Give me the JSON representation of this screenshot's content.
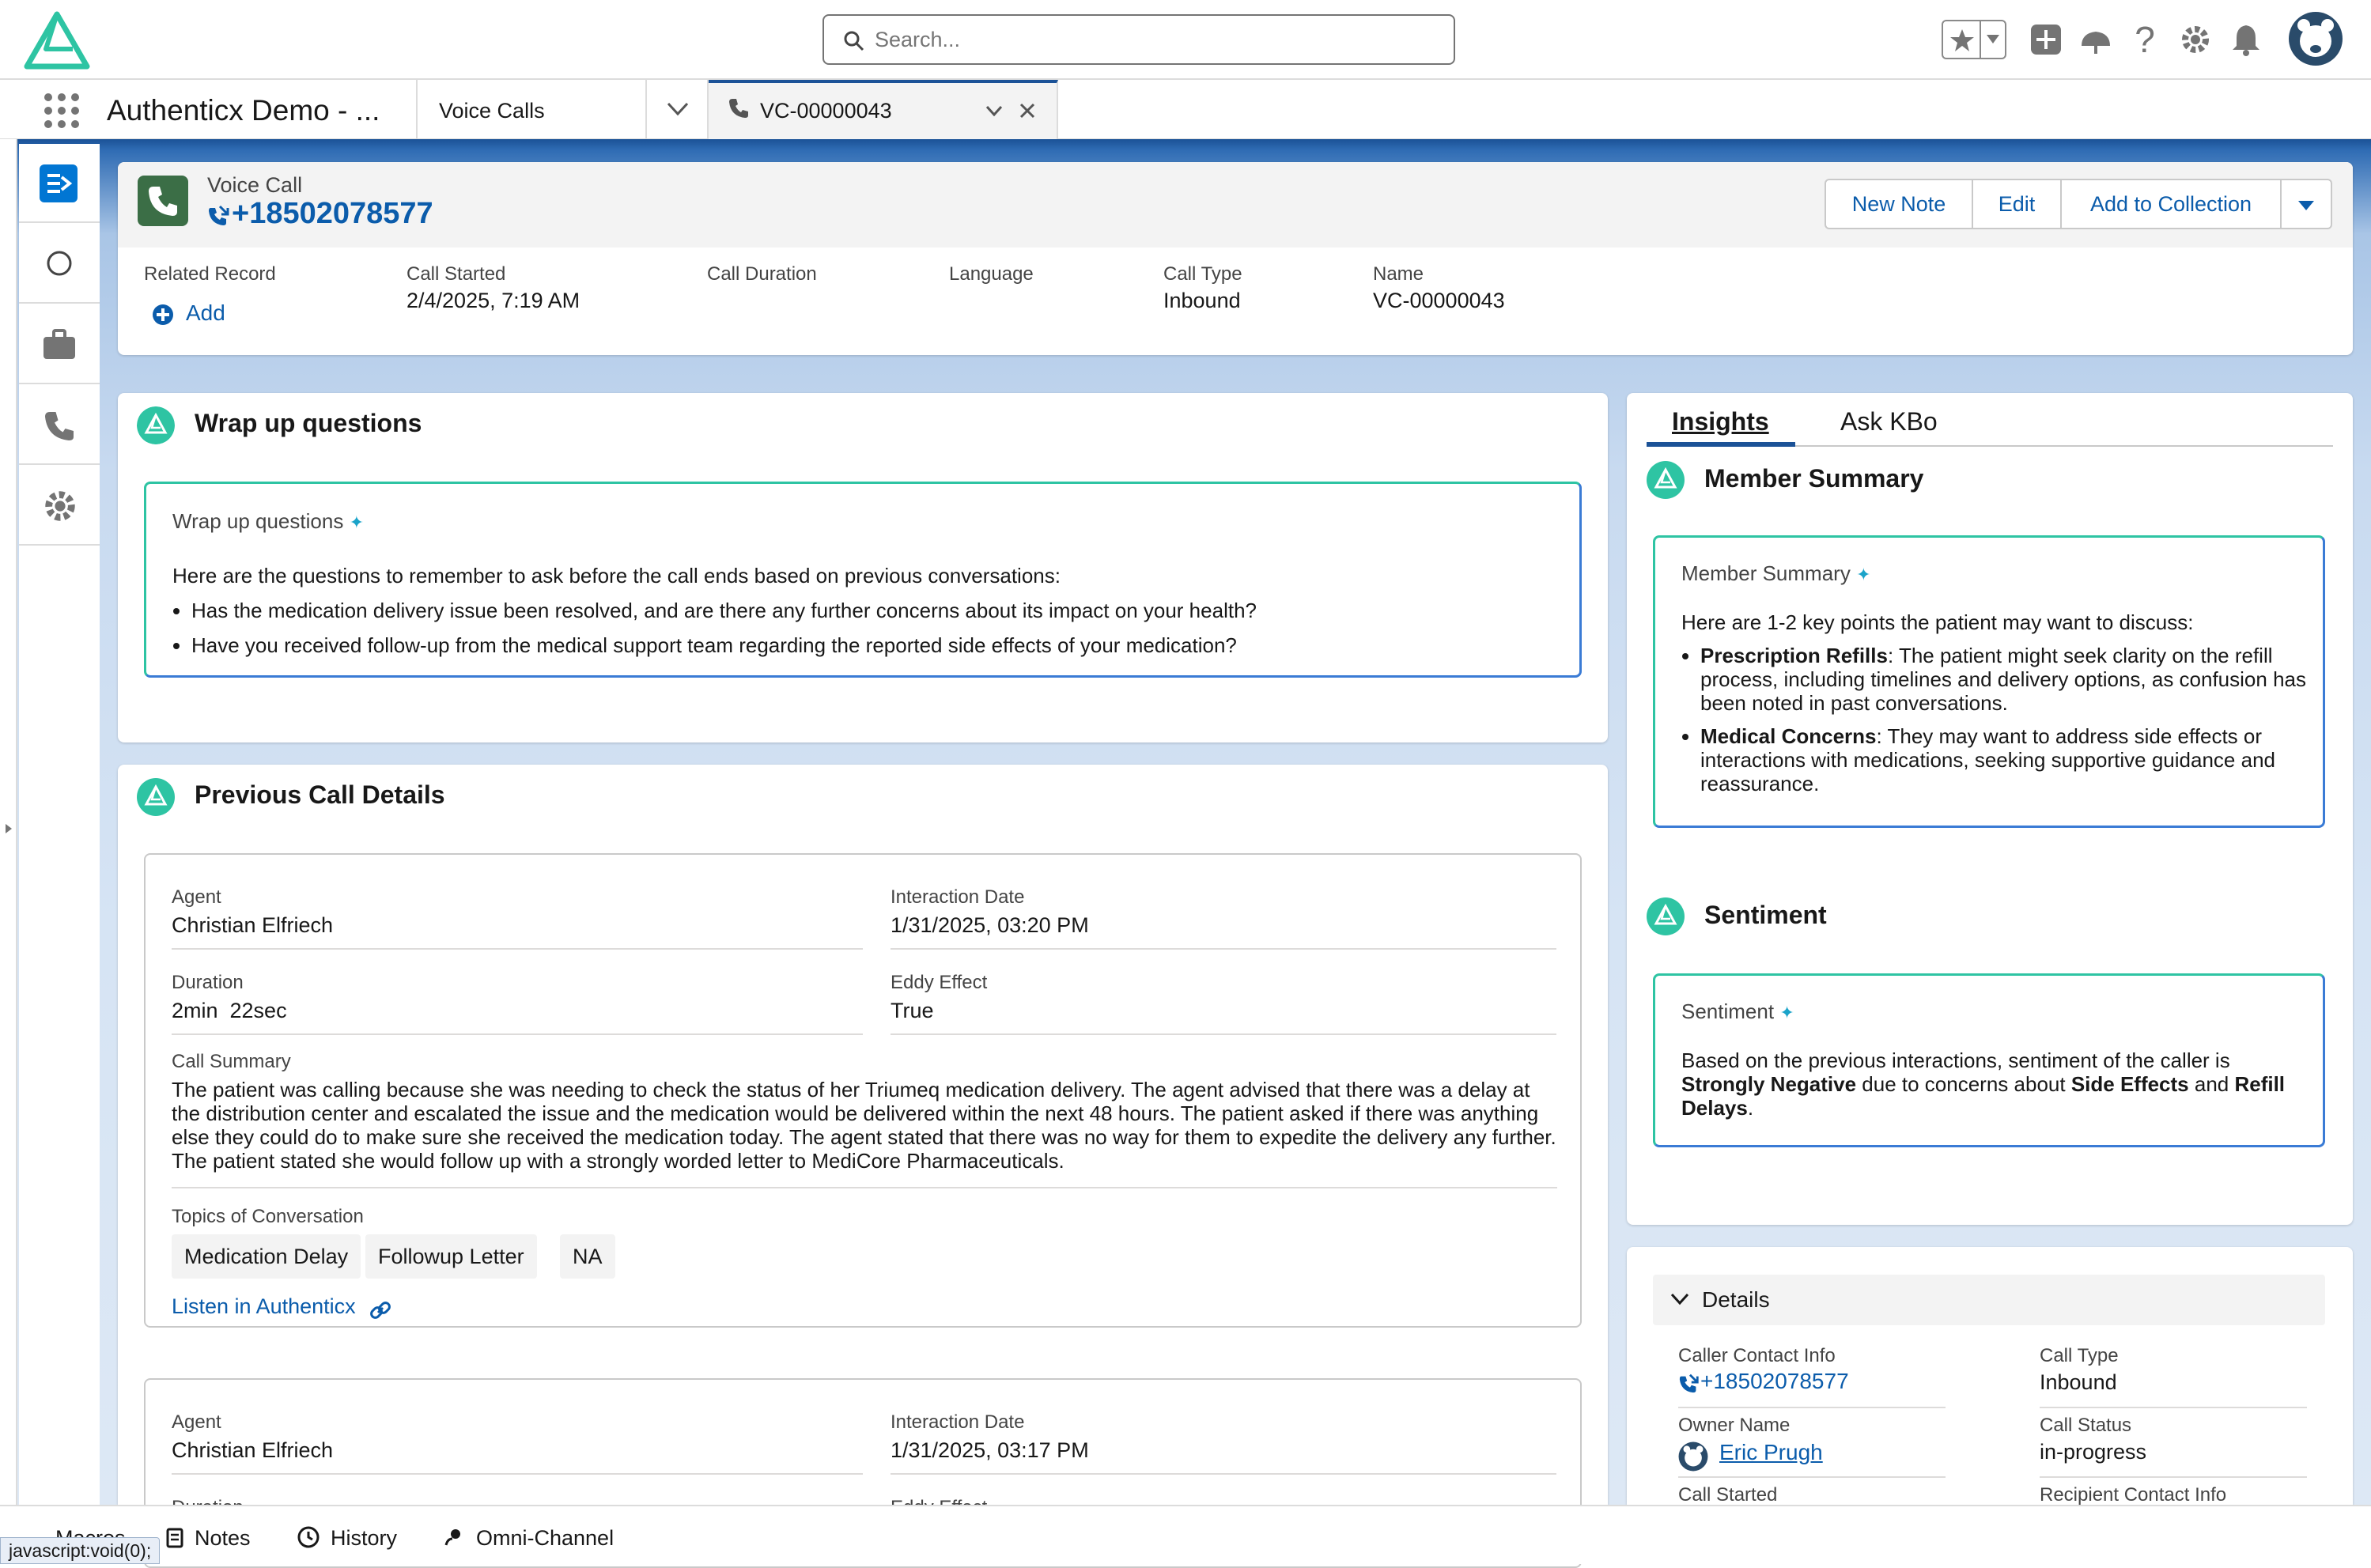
{
  "colors": {
    "brand_teal": "#2ec4a3",
    "link": "#0b5cab",
    "header_blue": "#1b5297",
    "active_nav": "#0176d3",
    "phone_green": "#3b6e46"
  },
  "header": {
    "search_placeholder": "Search...",
    "logo": "authenticx-logo"
  },
  "tabs": {
    "app_name": "Authenticx Demo - ...",
    "object_tab": "Voice Calls",
    "record_tab": "VC-00000043"
  },
  "record": {
    "object": "Voice Call",
    "title": "+18502078577",
    "actions": {
      "new_note": "New Note",
      "edit": "Edit",
      "add_to_collection": "Add to Collection"
    },
    "fields": {
      "related_record_label": "Related Record",
      "related_record_action": "Add",
      "call_started_label": "Call Started",
      "call_started": "2/4/2025, 7:19 AM",
      "call_duration_label": "Call Duration",
      "language_label": "Language",
      "call_type_label": "Call Type",
      "call_type": "Inbound",
      "name_label": "Name",
      "name": "VC-00000043"
    }
  },
  "wrap_up": {
    "title": "Wrap up questions",
    "box_title": "Wrap up questions",
    "intro": "Here are the questions to remember to ask before the call ends based on previous conversations:",
    "items": [
      "Has the medication delivery issue been resolved, and are there any further concerns about its impact on your health?",
      "Have you received follow-up from the medical support team regarding the reported side effects of your medication?"
    ]
  },
  "previous_calls": {
    "title": "Previous Call Details",
    "calls": [
      {
        "agent_label": "Agent",
        "agent": "Christian Elfriech",
        "date_label": "Interaction Date",
        "date": "1/31/2025, 03:20 PM",
        "duration_label": "Duration",
        "duration": "2min  22sec",
        "eddy_label": "Eddy Effect",
        "eddy": "True",
        "summary_label": "Call Summary",
        "summary": "The patient was calling because she was needing to check the status of her Triumeq medication delivery. The agent advised that there was a delay at the distribution center and escalated the issue and the medication would be delivered within the next 48 hours. The patient asked if there was anything else they could do to make sure she received the medication today. The agent stated that there was no way for them to expedite the delivery any further. The patient stated she would follow up with a strongly worded letter to MediCore Pharmaceuticals.",
        "topics_label": "Topics of Conversation",
        "topics": [
          "Medication Delay",
          "Followup Letter",
          "NA"
        ],
        "listen": "Listen in Authenticx"
      },
      {
        "agent_label": "Agent",
        "agent": "Christian Elfriech",
        "date_label": "Interaction Date",
        "date": "1/31/2025, 03:17 PM",
        "duration_label": "Duration",
        "eddy_label": "Eddy Effect"
      }
    ]
  },
  "insights": {
    "tabs": [
      "Insights",
      "Ask KBo"
    ],
    "member_summary": {
      "title": "Member Summary",
      "box_title": "Member Summary",
      "intro": "Here are 1-2 key points the patient may want to discuss:",
      "points": [
        {
          "bold": "Prescription Refills",
          "text": ": The patient might seek clarity on the refill process, including timelines and delivery options, as confusion has been noted in past conversations."
        },
        {
          "bold": "Medical Concerns",
          "text": ": They may want to address side effects or interactions with medications, seeking supportive guidance and reassurance."
        }
      ]
    },
    "sentiment": {
      "title": "Sentiment",
      "box_title": "Sentiment",
      "text_1": "Based on the previous interactions, sentiment of the caller is ",
      "bold_1": "Strongly Negative",
      "text_2": " due to concerns about ",
      "bold_2": "Side Effects",
      "text_3": " and ",
      "bold_3": "Refill Delays",
      "text_4": "."
    }
  },
  "details": {
    "title": "Details",
    "caller_contact_label": "Caller Contact Info",
    "caller_contact": "+18502078577",
    "call_type_label": "Call Type",
    "call_type": "Inbound",
    "owner_label": "Owner Name",
    "owner": "Eric Prugh",
    "call_status_label": "Call Status",
    "call_status": "in-progress",
    "call_started_label": "Call Started",
    "recipient_label": "Recipient Contact Info"
  },
  "utility_bar": {
    "macros": "Macros",
    "notes": "Notes",
    "history": "History",
    "omni": "Omni-Channel",
    "status_url": "javascript:void(0);"
  }
}
